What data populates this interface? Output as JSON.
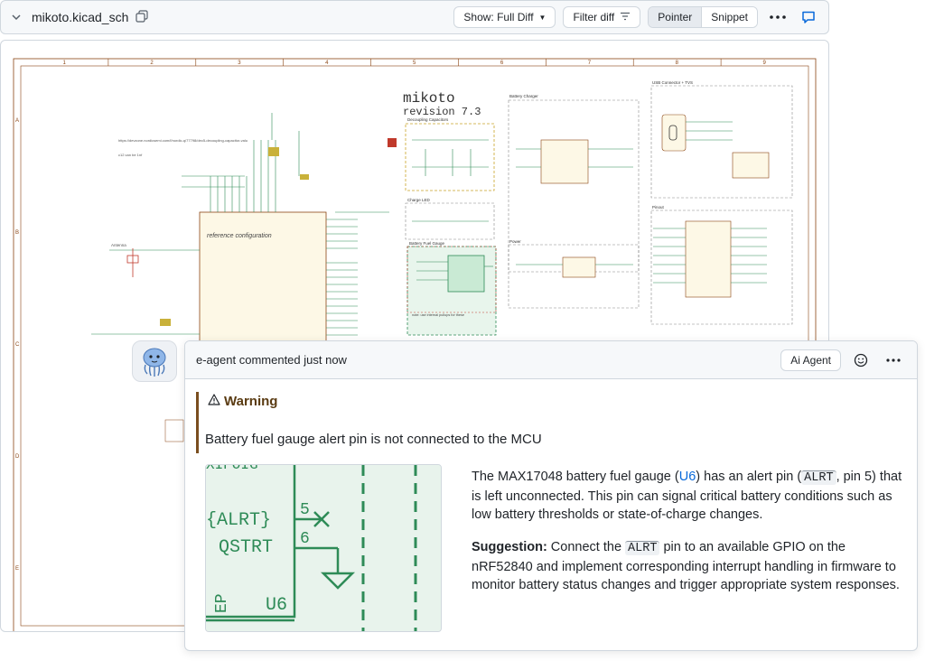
{
  "file": {
    "name": "mikoto.kicad_sch",
    "show_label": "Show: Full Diff",
    "filter_label": "Filter diff",
    "view_modes": [
      "Pointer",
      "Snippet"
    ],
    "active_mode": "Pointer"
  },
  "schematic": {
    "title_line1": "mikoto",
    "title_line2": "revision 7.3",
    "col_numbers": [
      "1",
      "2",
      "3",
      "4",
      "5",
      "6",
      "7",
      "8",
      "9"
    ],
    "row_letters": [
      "A",
      "B",
      "C",
      "D",
      "E"
    ],
    "labels": {
      "ref_config": "reference configuration",
      "decoupling": "Decoupling Capacitors",
      "charge_led": "Charge LED",
      "battery_charger": "Battery Charger",
      "usb": "USB Connector + TVS",
      "battery_fuel_gauge": "Battery Fuel Gauge",
      "power": "Power",
      "pinout": "Pinout",
      "antenna": "Antenna",
      "note_url": "https://devzone.nordicsemi.com/f/nordic-q/77798/dec5-decoupling-capacitor-valu",
      "note_c12": "c12 can be 1nf",
      "pullups_note": "note: use internal pullups for these"
    }
  },
  "comment": {
    "author": "e-agent",
    "action": "commented just now",
    "badge": "Ai Agent",
    "warning_title": "Warning",
    "warning_text": "Battery fuel gauge alert pin is not connected to the MCU",
    "crop_labels": {
      "alrt": "{ALRT}",
      "qstrt": "QSTRT",
      "pin5": "5",
      "pin6": "6",
      "u6": "U6",
      "ep": "EP",
      "top": "XIPOIG"
    },
    "paragraph1": {
      "a": "The MAX17048 battery fuel gauge (",
      "link": "U6",
      "b": ") has an alert pin (",
      "code": "ALRT",
      "c": ", pin 5) that is left unconnected. This pin can signal critical battery conditions such as low battery thresholds or state-of-charge changes."
    },
    "paragraph2": {
      "strong": "Suggestion:",
      "a": " Connect the ",
      "code": "ALRT",
      "b": " pin to an available GPIO on the nRF52840 and implement corresponding interrupt handling in firmware to monitor battery status changes and trigger appropriate system responses."
    }
  },
  "colors": {
    "accent": "#0969da",
    "warning": "#7a4e1f",
    "schematic_green": "#2e8b57",
    "schematic_red": "#c0392b",
    "schematic_line": "#8b4513"
  }
}
